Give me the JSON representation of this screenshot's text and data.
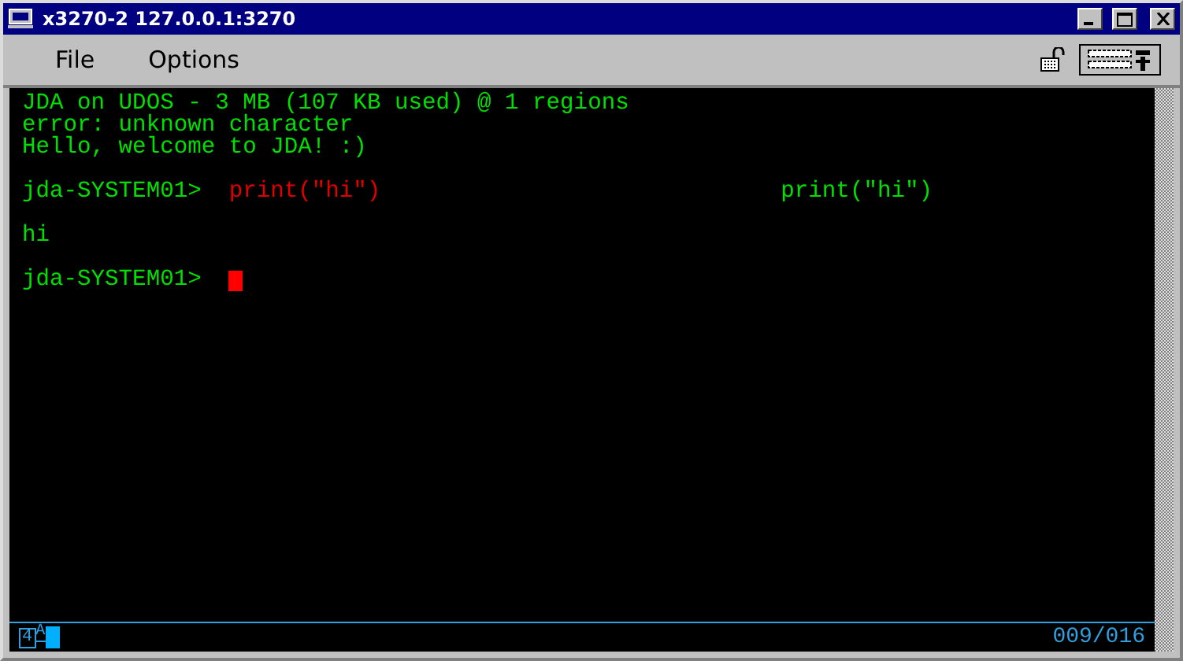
{
  "window": {
    "title": "x3270-2 127.0.0.1:3270"
  },
  "menu": [
    {
      "label": "File"
    },
    {
      "label": "Options"
    }
  ],
  "terminal": {
    "lines": [
      {
        "kind": "output",
        "text": "JDA on UDOS - 3 MB (107 KB used) @ 1 regions"
      },
      {
        "kind": "output",
        "text": "error: unknown character"
      },
      {
        "kind": "output",
        "text": "Hello, welcome to JDA! :)"
      },
      {
        "kind": "blank"
      },
      {
        "kind": "prompt",
        "prompt": "jda-SYSTEM01>",
        "command": "print(\"hi\")",
        "echo": "print(\"hi\")"
      },
      {
        "kind": "blank"
      },
      {
        "kind": "output",
        "text": "hi"
      },
      {
        "kind": "blank"
      },
      {
        "kind": "input",
        "prompt": "jda-SYSTEM01>"
      }
    ]
  },
  "status": {
    "indicator": "4",
    "mode": "A",
    "position": "009/016"
  }
}
